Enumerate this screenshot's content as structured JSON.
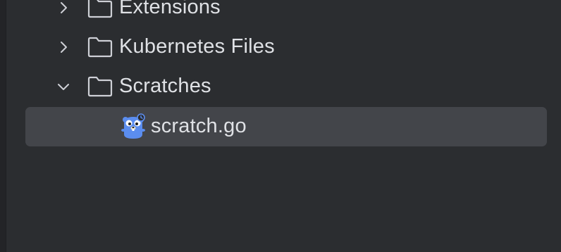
{
  "tree": {
    "items": [
      {
        "label": "Extensions",
        "expanded": false,
        "icon": "folder-icon"
      },
      {
        "label": "Kubernetes Files",
        "expanded": false,
        "icon": "folder-icon"
      },
      {
        "label": "Scratches",
        "expanded": true,
        "icon": "folder-icon"
      },
      {
        "label": "scratch.go",
        "selected": true,
        "icon": "go-gopher-icon"
      }
    ]
  },
  "colors": {
    "background": "#2b2d30",
    "selection": "#43454a",
    "text": "#dfe1e5",
    "icon_stroke": "#ced0d6",
    "gopher": "#5b8def"
  }
}
